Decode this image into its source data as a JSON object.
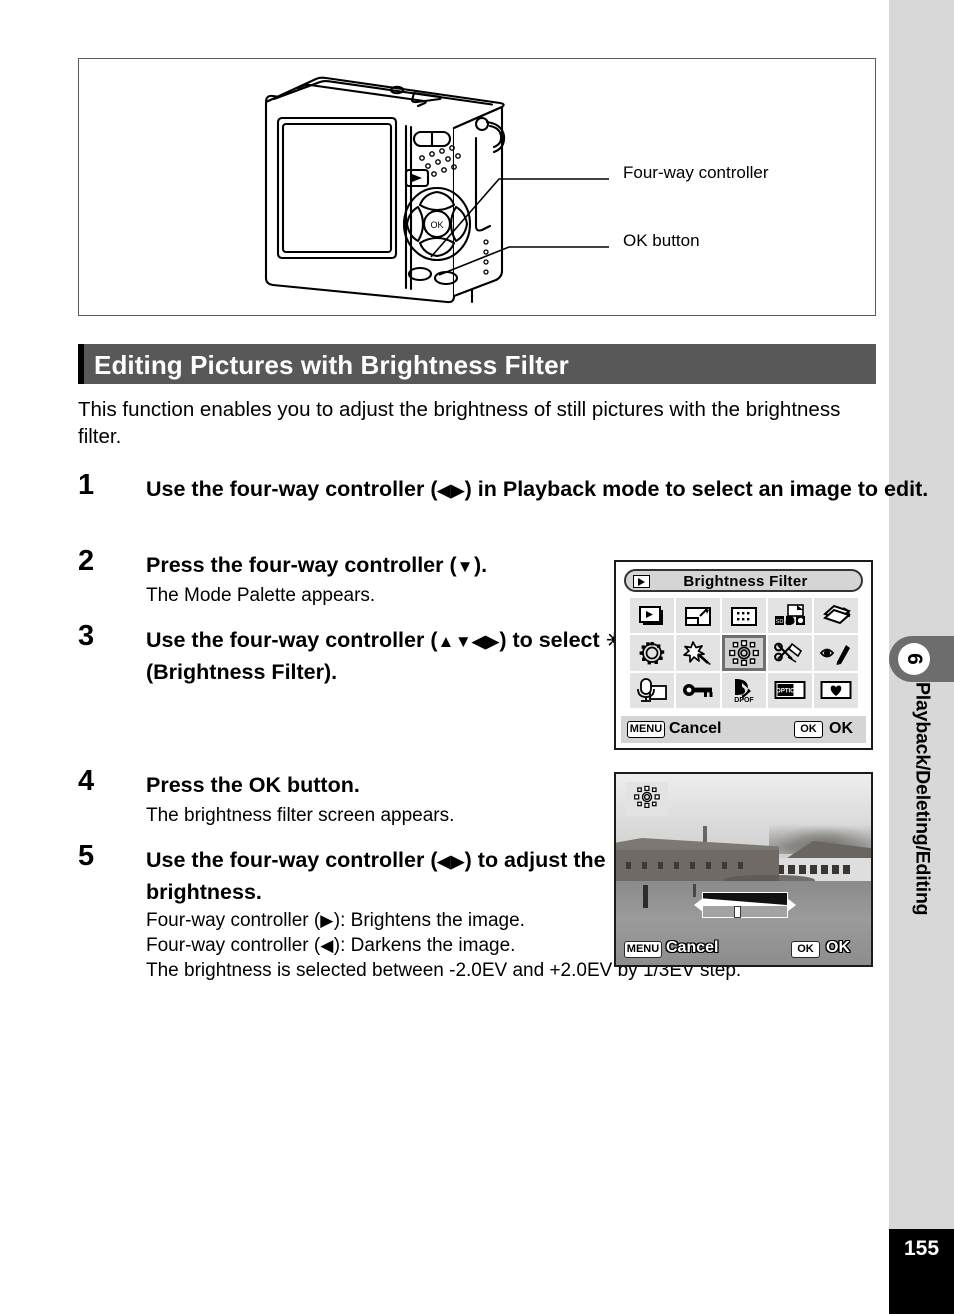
{
  "page": {
    "number": "155",
    "chapter_number": "6",
    "chapter_title": "Playback/Deleting/Editing"
  },
  "illustration": {
    "callout_fourway": "Four-way controller",
    "callout_ok": "OK button"
  },
  "section": {
    "heading": "Editing Pictures with Brightness Filter",
    "intro": "This function enables you to adjust the brightness of still pictures with the brightness filter."
  },
  "steps": [
    {
      "number": "1",
      "title_part1": "Use the four-way controller (",
      "arrows": "◀▶",
      "title_part2": ") in Playback mode to select an image to edit.",
      "note": ""
    },
    {
      "number": "2",
      "title_part1": "Press the four-way controller (",
      "arrows": "▼",
      "title_part2": ").",
      "note": "The Mode Palette appears."
    },
    {
      "number": "3",
      "title_part1": "Use the four-way controller (",
      "arrows": "▲▼◀▶",
      "title_part2": ") to select",
      "glyph": "☀",
      "title_part3": "(Brightness Filter).",
      "note": ""
    },
    {
      "number": "4",
      "title_part1": "Press the OK button.",
      "arrows": "",
      "title_part2": "",
      "note": "The brightness filter screen appears."
    },
    {
      "number": "5",
      "title_part1": "Use the four-way controller (",
      "arrows": "◀▶",
      "title_part2": ") to adjust the brightness.",
      "note_line1_a": "Four-way controller (",
      "note_line1_arrow": "▶",
      "note_line1_b": "): Brightens the image.",
      "note_line2_a": "Four-way controller (",
      "note_line2_arrow": "◀",
      "note_line2_b": "): Darkens the image.",
      "note_line3": "The brightness is selected between -2.0EV and +2.0EV by 1/3EV step."
    }
  ],
  "mode_palette_screen": {
    "title": "Brightness Filter",
    "menu_key": "MENU",
    "cancel_label": "Cancel",
    "ok_key": "OK",
    "ok_label": "OK",
    "icons": [
      "slideshow-icon",
      "resize-icon",
      "crop-icon",
      "image-copy-icon",
      "rotate-icon",
      "frame-composite-icon",
      "digital-filter-icon",
      "brightness-filter-icon",
      "red-eye-compensation-icon",
      "draw-edit-icon",
      "voice-memo-icon",
      "protect-key-icon",
      "dpof-icon",
      "start-screen-icon",
      "favorite-heart-icon"
    ],
    "selected_icon": "brightness-filter-icon",
    "dpof_label": "DPOF",
    "start_screen_label": "OPTIO"
  },
  "brightness_screen": {
    "menu_key": "MENU",
    "cancel_label": "Cancel",
    "ok_key": "OK",
    "ok_label": "OK",
    "mode_badge": "brightness-filter-icon",
    "slider_position_percent": 50
  },
  "colors": {
    "heading_bar": "#585858",
    "sidebar": "#d8d8d8",
    "chapter_tab": "#6d6d6d",
    "page_block": "#000000"
  }
}
